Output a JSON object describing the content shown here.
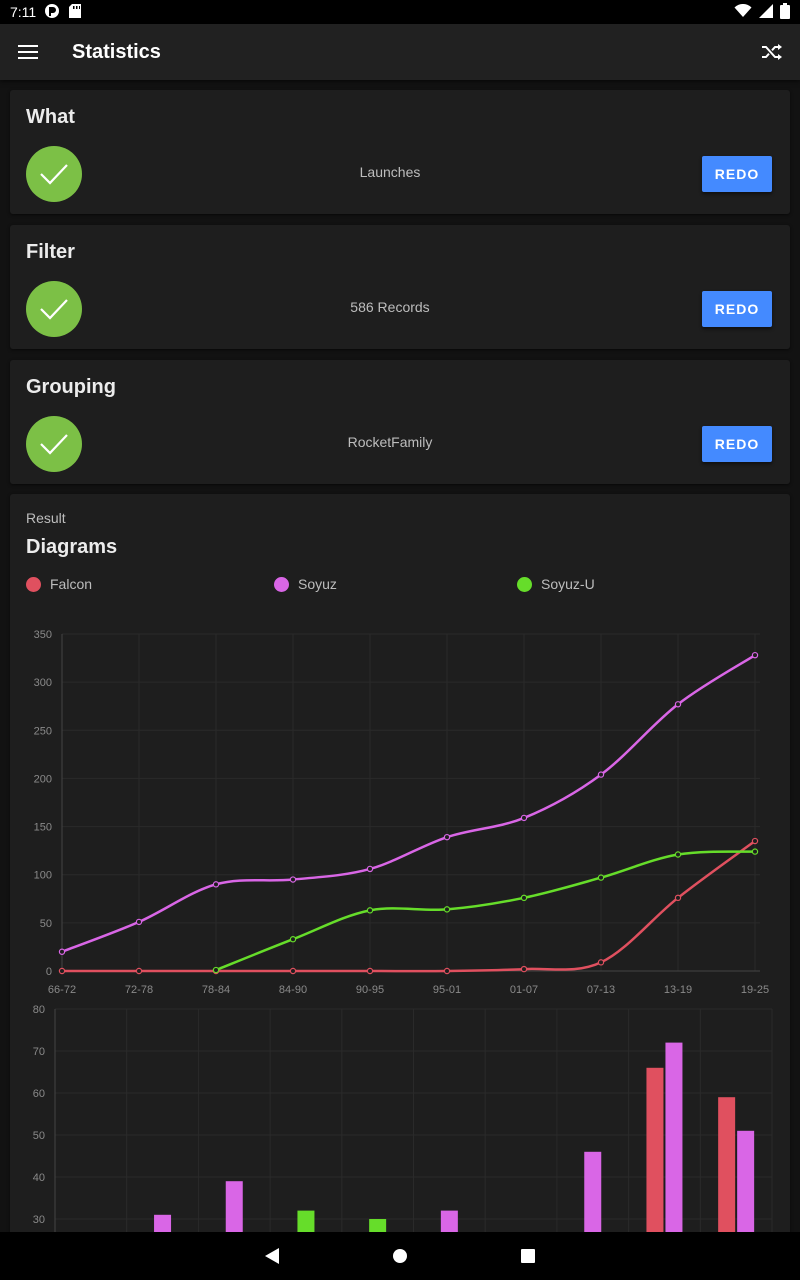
{
  "status_bar": {
    "time": "7:11",
    "icons": [
      "notification-icon",
      "sd-card-icon",
      "wifi-icon",
      "signal-icon",
      "battery-icon"
    ]
  },
  "app_bar": {
    "title": "Statistics",
    "menu_icon": "menu-icon",
    "action_icon": "shuffle-icon"
  },
  "steps": [
    {
      "heading": "What",
      "value": "Launches",
      "button": "REDO"
    },
    {
      "heading": "Filter",
      "value": "586 Records",
      "button": "REDO"
    },
    {
      "heading": "Grouping",
      "value": "RocketFamily",
      "button": "REDO"
    }
  ],
  "result": {
    "overline": "Result",
    "heading": "Diagrams",
    "legend": [
      {
        "label": "Falcon",
        "color": "#e0505f"
      },
      {
        "label": "Soyuz",
        "color": "#d966e6"
      },
      {
        "label": "Soyuz-U",
        "color": "#66dd2a"
      }
    ]
  },
  "chart_data": [
    {
      "type": "line",
      "categories": [
        "66-72",
        "72-78",
        "78-84",
        "84-90",
        "90-95",
        "95-01",
        "01-07",
        "07-13",
        "13-19",
        "19-25"
      ],
      "ylim": [
        0,
        350
      ],
      "yticks": [
        0,
        50,
        100,
        150,
        200,
        250,
        300,
        350
      ],
      "grid": true,
      "legend": "top",
      "series": [
        {
          "name": "Falcon",
          "color": "#e0505f",
          "values": [
            0,
            0,
            0,
            0,
            0,
            0,
            2,
            9,
            76,
            135
          ]
        },
        {
          "name": "Soyuz",
          "color": "#d966e6",
          "values": [
            20,
            51,
            90,
            95,
            106,
            139,
            159,
            204,
            277,
            328
          ]
        },
        {
          "name": "Soyuz-U",
          "color": "#66dd2a",
          "values": [
            null,
            null,
            1,
            33,
            63,
            64,
            76,
            97,
            121,
            124
          ]
        }
      ]
    },
    {
      "type": "bar",
      "ylim": [
        0,
        80
      ],
      "yticks": [
        30,
        40,
        50,
        60,
        70,
        80
      ],
      "grid": true,
      "groups": 10,
      "series": [
        {
          "name": "Falcon",
          "color": "#e0505f",
          "values": [
            0,
            0,
            0,
            0,
            0,
            0,
            0,
            0,
            66,
            59
          ]
        },
        {
          "name": "Soyuz",
          "color": "#d966e6",
          "values": [
            0,
            31,
            39,
            0,
            0,
            32,
            0,
            46,
            72,
            51
          ]
        },
        {
          "name": "Soyuz-U",
          "color": "#66dd2a",
          "values": [
            0,
            0,
            0,
            32,
            30,
            0,
            0,
            0,
            0,
            0
          ]
        }
      ]
    }
  ],
  "nav_bar": {
    "back": "back-icon",
    "home": "home-icon",
    "recents": "recents-icon"
  }
}
